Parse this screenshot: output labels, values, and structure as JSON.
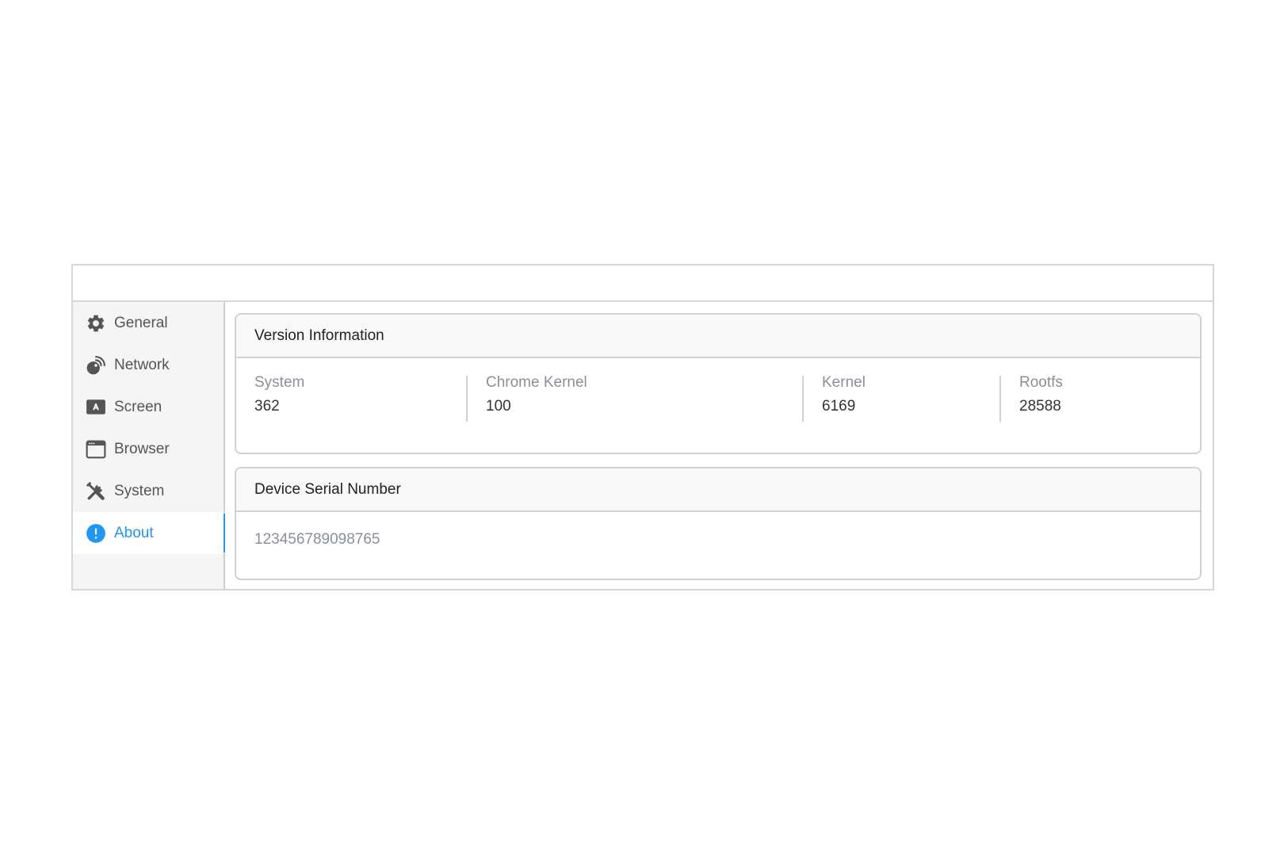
{
  "sidebar": {
    "items": [
      {
        "label": "General",
        "icon": "gear-icon"
      },
      {
        "label": "Network",
        "icon": "network-icon"
      },
      {
        "label": "Screen",
        "icon": "screen-icon"
      },
      {
        "label": "Browser",
        "icon": "browser-icon"
      },
      {
        "label": "System",
        "icon": "tools-icon"
      },
      {
        "label": "About",
        "icon": "info-icon",
        "active": true
      }
    ]
  },
  "version": {
    "title": "Version Information",
    "fields": [
      {
        "label": "System",
        "value": "362"
      },
      {
        "label": "Chrome Kernel",
        "value": "100"
      },
      {
        "label": "Kernel",
        "value": "6169"
      },
      {
        "label": "Rootfs",
        "value": "28588"
      }
    ]
  },
  "serial": {
    "title": "Device Serial Number",
    "value": "123456789098765"
  },
  "colors": {
    "accent": "#2196f3",
    "icon": "#555555",
    "muted_text": "#8a8f99"
  }
}
